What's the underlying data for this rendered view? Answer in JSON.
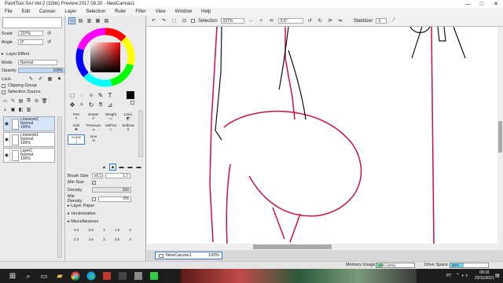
{
  "title": "PaintTool SAI Ver.2 (32bit) Preview.2017.08.20 - NewCanvas1",
  "window_controls": [
    "—",
    "□",
    "✕"
  ],
  "menu": [
    "File",
    "Edit",
    "Canvas",
    "Layer",
    "Selection",
    "Ruler",
    "Filter",
    "View",
    "Window",
    "Help"
  ],
  "left": {
    "scale_label": "Scale",
    "scale_value": "237%",
    "angle_label": "Angle",
    "angle_value": "0°",
    "layer_effect": "Layer Effect",
    "mode_label": "Mode",
    "mode_value": "Normal",
    "opacity_label": "Opacity",
    "opacity_value": "100%",
    "lock_label": "Lock",
    "clipping": "Clipping Group",
    "selection_source": "Selection Source",
    "layers": [
      {
        "name": "Linework2",
        "mode": "Normal",
        "opacity": "100%"
      },
      {
        "name": "Linework1",
        "mode": "Normal",
        "opacity": "100%"
      },
      {
        "name": "Layer1",
        "mode": "Normal",
        "opacity": "100%"
      }
    ]
  },
  "tools": {
    "rows": [
      [
        "Pen",
        "Eraser",
        "Weight",
        "Color"
      ],
      [
        "Edit",
        "Pressure",
        "SelPen",
        "SelEras"
      ],
      [
        "Curve",
        "Line",
        "",
        ""
      ]
    ],
    "brush_size_label": "Brush Size",
    "brush_size_mult": "x0.1",
    "brush_size_value": "1.7",
    "min_size_label": "Min Size",
    "density_label": "Density",
    "density_value": "100",
    "min_density_label": "Min Density",
    "min_density_value": "0%",
    "layer_paper": "Layer Paper",
    "vectorization": "Vectorization",
    "miscellaneous": "Miscellaneous",
    "sizes_row1": [
      "0.4",
      "0.8",
      "1",
      "1.5",
      "2"
    ],
    "sizes_row2": [
      "2.3",
      "2.6",
      "3",
      "3.5",
      "4"
    ]
  },
  "toolbar": {
    "selection_label": "Selection",
    "zoom": "237%",
    "angle": "0.0°",
    "stabilizer_label": "Stabilizer",
    "stabilizer_value": "3"
  },
  "doc": {
    "name": "NewCanvas1",
    "zoom": "100%"
  },
  "status": {
    "memory_label": "Memory Usage",
    "memory_value": "16% (16%)",
    "memory_fraction": 0.16,
    "drive_label": "Drive Space",
    "drive_value": "36%",
    "drive_fraction": 0.36
  },
  "taskbar": {
    "lang": "PT",
    "time": "09:16",
    "date": "23/11/2021"
  },
  "colors": {
    "accent": "#3a78d8",
    "stroke": "#cc1040",
    "taskbar": "#1c1c1c"
  }
}
